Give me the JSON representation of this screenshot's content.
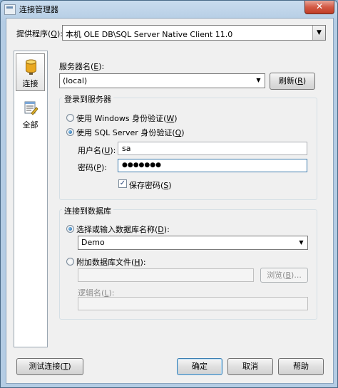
{
  "window": {
    "title": "连接管理器",
    "close_glyph": "✕"
  },
  "provider": {
    "label": "提供程序(",
    "hotkey": "Q",
    "label_end": "):",
    "value": "本机 OLE DB\\SQL Server Native Client 11.0"
  },
  "nav": [
    {
      "label": "连接",
      "icon": "database-icon",
      "selected": true
    },
    {
      "label": "全部",
      "icon": "properties-icon",
      "selected": false
    }
  ],
  "server": {
    "label": "服务器名(",
    "hotkey": "E",
    "label_end": "):",
    "value": "(local)",
    "refresh_label": "刷新(",
    "refresh_hotkey": "R",
    "refresh_end": ")"
  },
  "login": {
    "group_title": "登录到服务器",
    "windows_auth": {
      "label": "使用 Windows 身份验证(",
      "hotkey": "W",
      "end": ")"
    },
    "sql_auth": {
      "label": "使用 SQL Server 身份验证(",
      "hotkey": "Q",
      "end": ")"
    },
    "username": {
      "label": "用户名(",
      "hotkey": "U",
      "end": "):",
      "value": "sa"
    },
    "password": {
      "label": "密码(",
      "hotkey": "P",
      "end": "):",
      "value": "●●●●●●●"
    },
    "save_password": {
      "label": "保存密码(",
      "hotkey": "S",
      "end": ")",
      "checked": true
    }
  },
  "database": {
    "group_title": "连接到数据库",
    "select_db": {
      "label": "选择或输入数据库名称(",
      "hotkey": "D",
      "end": "):",
      "value": "Demo"
    },
    "attach_file": {
      "label": "附加数据库文件(",
      "hotkey": "H",
      "end": "):",
      "value": ""
    },
    "browse": {
      "label": "浏览(",
      "hotkey": "B",
      "end": ")..."
    },
    "logical_name": {
      "label": "逻辑名(",
      "hotkey": "L",
      "end": "):",
      "value": ""
    }
  },
  "footer": {
    "test": {
      "label": "测试连接(",
      "hotkey": "T",
      "end": ")"
    },
    "ok": "确定",
    "cancel": "取消",
    "help": "帮助"
  }
}
